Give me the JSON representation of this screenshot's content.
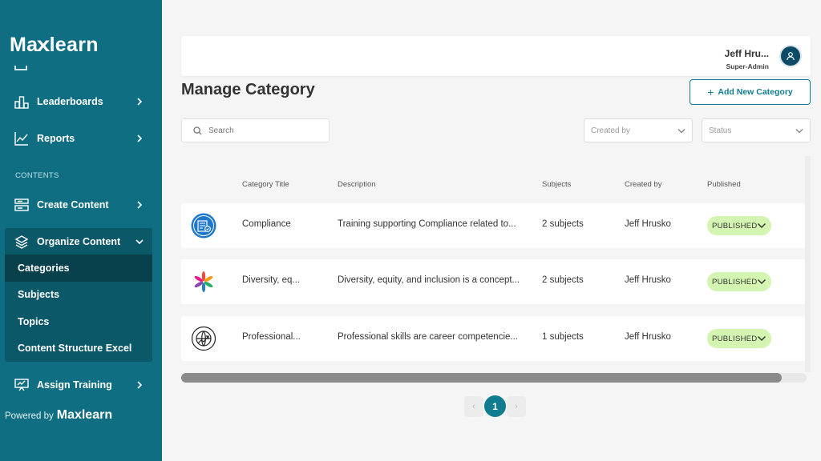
{
  "sidebar": {
    "logo_pre": "Ma",
    "logo_x": "x",
    "logo_post": "learn",
    "items": [
      {
        "label": "Leaderboards",
        "icon": "leaderboard-icon"
      },
      {
        "label": "Reports",
        "icon": "reports-icon"
      }
    ],
    "section_label": "CONTENTS",
    "create_content": "Create Content",
    "organize_content": "Organize Content",
    "sub_items": [
      "Categories",
      "Subjects",
      "Topics",
      "Content Structure Excel"
    ],
    "active_sub_item": "Categories",
    "assign_training": "Assign Training",
    "powered_by": "Powered by",
    "powered_logo": "Maxlearn"
  },
  "header": {
    "user_name": "Jeff Hru...",
    "user_role": "Super-Admin"
  },
  "page": {
    "title": "Manage Category",
    "add_button": "Add New Category"
  },
  "filters": {
    "search_placeholder": "Search",
    "created_by_placeholder": "Created by",
    "status_placeholder": "Status"
  },
  "table": {
    "columns": [
      "Category Title",
      "Description",
      "Subjects",
      "Created by",
      "Published"
    ],
    "rows": [
      {
        "icon": "compliance-icon",
        "title": "Compliance",
        "description": "Training supporting Compliance related to...",
        "subjects": "2 subjects",
        "created_by": "Jeff Hrusko",
        "status": "PUBLISHED"
      },
      {
        "icon": "diversity-icon",
        "title": "Diversity, eq...",
        "description": "Diversity, equity, and inclusion is a concept...",
        "subjects": "2 subjects",
        "created_by": "Jeff Hrusko",
        "status": "PUBLISHED"
      },
      {
        "icon": "professional-skills-icon",
        "title": "Professional...",
        "description": "Professional skills are career competencie...",
        "subjects": "1 subjects",
        "created_by": "Jeff Hrusko",
        "status": "PUBLISHED"
      }
    ]
  },
  "pagination": {
    "prev": "‹",
    "current_page": "1",
    "next": "›"
  },
  "colors": {
    "sidebar": "#0f6e82",
    "accent": "#0f7d8f",
    "published_badge": "#d4f5b2"
  }
}
